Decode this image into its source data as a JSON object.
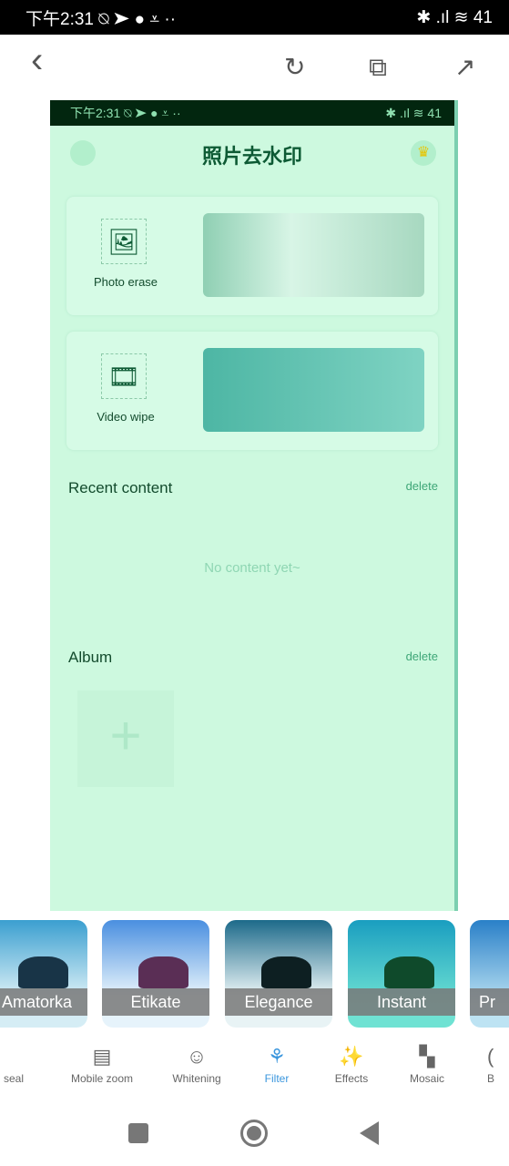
{
  "status_bar": {
    "time": "下午2:31",
    "icons": "⍉ ➤ ● ⩡ ··",
    "right": "✱ .ıl ≋ 41"
  },
  "toolbar": {
    "back": "‹",
    "refresh": "↻",
    "copy": "⧉",
    "share": "↗"
  },
  "preview": {
    "status_time": "下午2:31",
    "status_icons": "⍉ ➤ ● ⩡ ··",
    "status_right": "✱ .ıl ≋ 41",
    "title": "照片去水印",
    "cards": [
      {
        "label": "Photo erase",
        "icon": "image-icon"
      },
      {
        "label": "Video wipe",
        "icon": "film-icon"
      }
    ],
    "recent_title": "Recent content",
    "recent_delete": "delete",
    "empty": "No content yet~",
    "album_title": "Album",
    "album_delete": "delete",
    "add": "+"
  },
  "filters": [
    {
      "label": "Amatorka"
    },
    {
      "label": "Etikate"
    },
    {
      "label": "Elegance"
    },
    {
      "label": "Instant"
    },
    {
      "label": "Pr"
    }
  ],
  "tools": [
    {
      "label": "seal",
      "icon": "seal-icon"
    },
    {
      "label": "Mobile zoom",
      "icon": "zoom-icon"
    },
    {
      "label": "Whitening",
      "icon": "face-icon"
    },
    {
      "label": "Filter",
      "icon": "filter-icon",
      "active": true
    },
    {
      "label": "Effects",
      "icon": "magic-wand-icon"
    },
    {
      "label": "Mosaic",
      "icon": "mosaic-icon"
    },
    {
      "label": "B",
      "icon": "b-icon"
    }
  ],
  "colors": {
    "accent": "#3a96dd",
    "preview_bg": "#cdf9df"
  }
}
